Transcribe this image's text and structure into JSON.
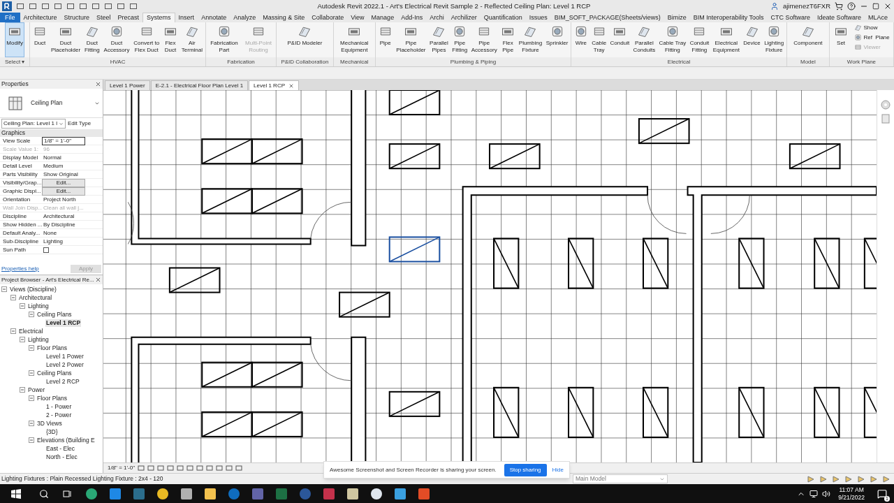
{
  "title_bar": {
    "title": "Autodesk Revit 2022.1 - Art's Electrical Revit Sample 2 - Reflected Ceiling Plan: Level 1 RCP",
    "user": "ajimenezT6FXR"
  },
  "ribbon_tabs": [
    {
      "label": "File",
      "selected": false,
      "kind": "file"
    },
    {
      "label": "Architecture",
      "selected": false,
      "kind": "tab"
    },
    {
      "label": "Structure",
      "selected": false,
      "kind": "tab"
    },
    {
      "label": "Steel",
      "selected": false,
      "kind": "tab"
    },
    {
      "label": "Precast",
      "selected": false,
      "kind": "tab"
    },
    {
      "label": "Systems",
      "selected": true,
      "kind": "tab"
    },
    {
      "label": "Insert",
      "selected": false,
      "kind": "tab"
    },
    {
      "label": "Annotate",
      "selected": false,
      "kind": "tab"
    },
    {
      "label": "Analyze",
      "selected": false,
      "kind": "tab"
    },
    {
      "label": "Massing & Site",
      "selected": false,
      "kind": "tab"
    },
    {
      "label": "Collaborate",
      "selected": false,
      "kind": "tab"
    },
    {
      "label": "View",
      "selected": false,
      "kind": "tab"
    },
    {
      "label": "Manage",
      "selected": false,
      "kind": "tab"
    },
    {
      "label": "Add-Ins",
      "selected": false,
      "kind": "tab"
    },
    {
      "label": "Archi",
      "selected": false,
      "kind": "tab"
    },
    {
      "label": "Archilizer",
      "selected": false,
      "kind": "tab"
    },
    {
      "label": "Quantification",
      "selected": false,
      "kind": "tab"
    },
    {
      "label": "Issues",
      "selected": false,
      "kind": "tab"
    },
    {
      "label": "BIM_SOFT_PACKAGE(Sheets/views)",
      "selected": false,
      "kind": "tab"
    },
    {
      "label": "Bimize",
      "selected": false,
      "kind": "tab"
    },
    {
      "label": "BIM Interoperability Tools",
      "selected": false,
      "kind": "tab"
    },
    {
      "label": "CTC Software",
      "selected": false,
      "kind": "tab"
    },
    {
      "label": "Ideate Software",
      "selected": false,
      "kind": "tab"
    },
    {
      "label": "MLAce",
      "selected": false,
      "kind": "tab"
    }
  ],
  "ribbon_groups": [
    {
      "label": "Select ▾",
      "tools": [
        {
          "label": "Modify",
          "selected": true,
          "disabled": false,
          "kind": "large"
        }
      ]
    },
    {
      "label": "HVAC",
      "tools": [
        {
          "label": "Duct",
          "selected": false,
          "disabled": false,
          "kind": "large"
        },
        {
          "label": "Duct\nPlaceholder",
          "selected": false,
          "disabled": false,
          "kind": "large"
        },
        {
          "label": "Duct\nFitting",
          "selected": false,
          "disabled": false,
          "kind": "large"
        },
        {
          "label": "Duct\nAccessory",
          "selected": false,
          "disabled": false,
          "kind": "large"
        },
        {
          "label": "Convert to\nFlex Duct",
          "selected": false,
          "disabled": false,
          "kind": "large"
        },
        {
          "label": "Flex\nDuct",
          "selected": false,
          "disabled": false,
          "kind": "large"
        },
        {
          "label": "Air\nTerminal",
          "selected": false,
          "disabled": false,
          "kind": "large"
        }
      ]
    },
    {
      "label": "Fabrication",
      "tools": [
        {
          "label": "Fabrication\nPart",
          "selected": false,
          "disabled": false,
          "kind": "large"
        },
        {
          "label": "Multi-Point\nRouting",
          "selected": false,
          "disabled": true,
          "kind": "large"
        }
      ]
    },
    {
      "label": "P&ID Collaboration",
      "tools": [
        {
          "label": "P&ID Modeler",
          "selected": false,
          "disabled": false,
          "kind": "large"
        }
      ]
    },
    {
      "label": "Mechanical",
      "tools": [
        {
          "label": "Mechanical\nEquipment",
          "selected": false,
          "disabled": false,
          "kind": "large"
        }
      ]
    },
    {
      "label": "Plumbing & Piping",
      "tools": [
        {
          "label": "Pipe",
          "selected": false,
          "disabled": false,
          "kind": "large"
        },
        {
          "label": "Pipe\nPlaceholder",
          "selected": false,
          "disabled": false,
          "kind": "large"
        },
        {
          "label": "Parallel\nPipes",
          "selected": false,
          "disabled": false,
          "kind": "large"
        },
        {
          "label": "Pipe\nFitting",
          "selected": false,
          "disabled": false,
          "kind": "large"
        },
        {
          "label": "Pipe\nAccessory",
          "selected": false,
          "disabled": false,
          "kind": "large"
        },
        {
          "label": "Flex\nPipe",
          "selected": false,
          "disabled": false,
          "kind": "large"
        },
        {
          "label": "Plumbing\nFixture",
          "selected": false,
          "disabled": false,
          "kind": "large"
        },
        {
          "label": "Sprinkler",
          "selected": false,
          "disabled": false,
          "kind": "large"
        }
      ]
    },
    {
      "label": "Electrical",
      "tools": [
        {
          "label": "Wire",
          "selected": false,
          "disabled": false,
          "kind": "large"
        },
        {
          "label": "Cable\nTray",
          "selected": false,
          "disabled": false,
          "kind": "large"
        },
        {
          "label": "Conduit",
          "selected": false,
          "disabled": false,
          "kind": "large"
        },
        {
          "label": "Parallel\nConduits",
          "selected": false,
          "disabled": false,
          "kind": "large"
        },
        {
          "label": "Cable Tray\nFitting",
          "selected": false,
          "disabled": false,
          "kind": "large"
        },
        {
          "label": "Conduit\nFitting",
          "selected": false,
          "disabled": false,
          "kind": "large"
        },
        {
          "label": "Electrical\nEquipment",
          "selected": false,
          "disabled": false,
          "kind": "large"
        },
        {
          "label": "Device",
          "selected": false,
          "disabled": false,
          "kind": "large"
        },
        {
          "label": "Lighting\nFixture",
          "selected": false,
          "disabled": false,
          "kind": "large"
        }
      ]
    },
    {
      "label": "Model",
      "tools": [
        {
          "label": "Component",
          "selected": false,
          "disabled": false,
          "kind": "large"
        }
      ]
    },
    {
      "label": "Work Plane",
      "tools": [
        {
          "label": "Set",
          "selected": false,
          "disabled": false,
          "kind": "large"
        },
        {
          "label": "Show",
          "selected": false,
          "disabled": false,
          "kind": "small"
        },
        {
          "label": "Ref  Plane",
          "selected": false,
          "disabled": false,
          "kind": "small"
        },
        {
          "label": "Viewer",
          "selected": false,
          "disabled": true,
          "kind": "small"
        }
      ]
    }
  ],
  "view_tabs": [
    {
      "label": "Level 1 Power",
      "selected": false
    },
    {
      "label": "E-2.1 - Electrical Floor Plan Level 1",
      "selected": false
    },
    {
      "label": "Level 1 RCP",
      "selected": true
    }
  ],
  "properties": {
    "title": "Properties",
    "type_name": "Ceiling Plan",
    "instance_selector": "Ceiling Plan: Level 1 l",
    "edit_type": "Edit Type",
    "section": "Graphics",
    "rows": [
      {
        "name": "View Scale",
        "value": "1/8\" = 1'-0\"",
        "kind": "field",
        "disabled": false
      },
      {
        "name": "Scale Value    1:",
        "value": "96",
        "kind": "text",
        "disabled": true
      },
      {
        "name": "Display Model",
        "value": "Normal",
        "kind": "text",
        "disabled": false
      },
      {
        "name": "Detail Level",
        "value": "Medium",
        "kind": "text",
        "disabled": false
      },
      {
        "name": "Parts Visibility",
        "value": "Show Original",
        "kind": "text",
        "disabled": false
      },
      {
        "name": "Visibility/Grap...",
        "value": "Edit...",
        "kind": "button",
        "disabled": false
      },
      {
        "name": "Graphic Displ...",
        "value": "Edit...",
        "kind": "button",
        "disabled": false
      },
      {
        "name": "Orientation",
        "value": "Project North",
        "kind": "text",
        "disabled": false
      },
      {
        "name": "Wall Join Disp...",
        "value": "Clean all wall j...",
        "kind": "text",
        "disabled": true
      },
      {
        "name": "Discipline",
        "value": "Architectural",
        "kind": "text",
        "disabled": false
      },
      {
        "name": "Show Hidden ...",
        "value": "By Discipline",
        "kind": "text",
        "disabled": false
      },
      {
        "name": "Default Analy...",
        "value": "None",
        "kind": "text",
        "disabled": false
      },
      {
        "name": "Sub-Discipline",
        "value": "Lighting",
        "kind": "text",
        "disabled": false
      },
      {
        "name": "Sun Path",
        "kind": "checkbox",
        "checked": false,
        "disabled": false
      }
    ],
    "help_link": "Properties help",
    "apply_button": "Apply"
  },
  "project_browser": {
    "title": "Project Browser - Art's Electrical Re...",
    "tree": [
      {
        "label": "Views (Discipline)",
        "selected": false,
        "children": [
          {
            "label": "Architectural",
            "selected": false,
            "children": [
              {
                "label": "Lighting",
                "selected": false,
                "children": [
                  {
                    "label": "Ceiling Plans",
                    "selected": false,
                    "children": [
                      {
                        "label": "Level 1 RCP",
                        "selected": true
                      }
                    ]
                  }
                ]
              }
            ]
          },
          {
            "label": "Electrical",
            "selected": false,
            "children": [
              {
                "label": "Lighting",
                "selected": false,
                "children": [
                  {
                    "label": "Floor Plans",
                    "selected": false,
                    "children": [
                      {
                        "label": "Level 1 Power",
                        "selected": false
                      },
                      {
                        "label": "Level 2 Power",
                        "selected": false
                      }
                    ]
                  },
                  {
                    "label": "Ceiling Plans",
                    "selected": false,
                    "children": [
                      {
                        "label": "Level 2 RCP",
                        "selected": false
                      }
                    ]
                  }
                ]
              },
              {
                "label": "Power",
                "selected": false,
                "children": [
                  {
                    "label": "Floor Plans",
                    "selected": false,
                    "children": [
                      {
                        "label": "1 - Power",
                        "selected": false
                      },
                      {
                        "label": "2 - Power",
                        "selected": false
                      }
                    ]
                  },
                  {
                    "label": "3D Views",
                    "selected": false,
                    "children": [
                      {
                        "label": "{3D}",
                        "selected": false
                      }
                    ]
                  },
                  {
                    "label": "Elevations (Building E",
                    "selected": false,
                    "children": [
                      {
                        "label": "East - Elec",
                        "selected": false
                      },
                      {
                        "label": "North - Elec",
                        "selected": false
                      }
                    ]
                  }
                ]
              }
            ]
          }
        ]
      }
    ]
  },
  "view_control_bar": {
    "scale": "1/8\" = 1'-0\""
  },
  "status_bar": {
    "text": "Lighting Fixtures : Plain Recessed Lighting Fixture : 2x4 - 120",
    "workset": "Main Model"
  },
  "share_notice": {
    "text": "Awesome Screenshot and Screen Recorder is sharing your screen.",
    "stop_button": "Stop sharing",
    "hide_link": "Hide"
  },
  "taskbar": {
    "time": "11:07 AM",
    "date": "9/21/2022",
    "notification_count": "1"
  }
}
